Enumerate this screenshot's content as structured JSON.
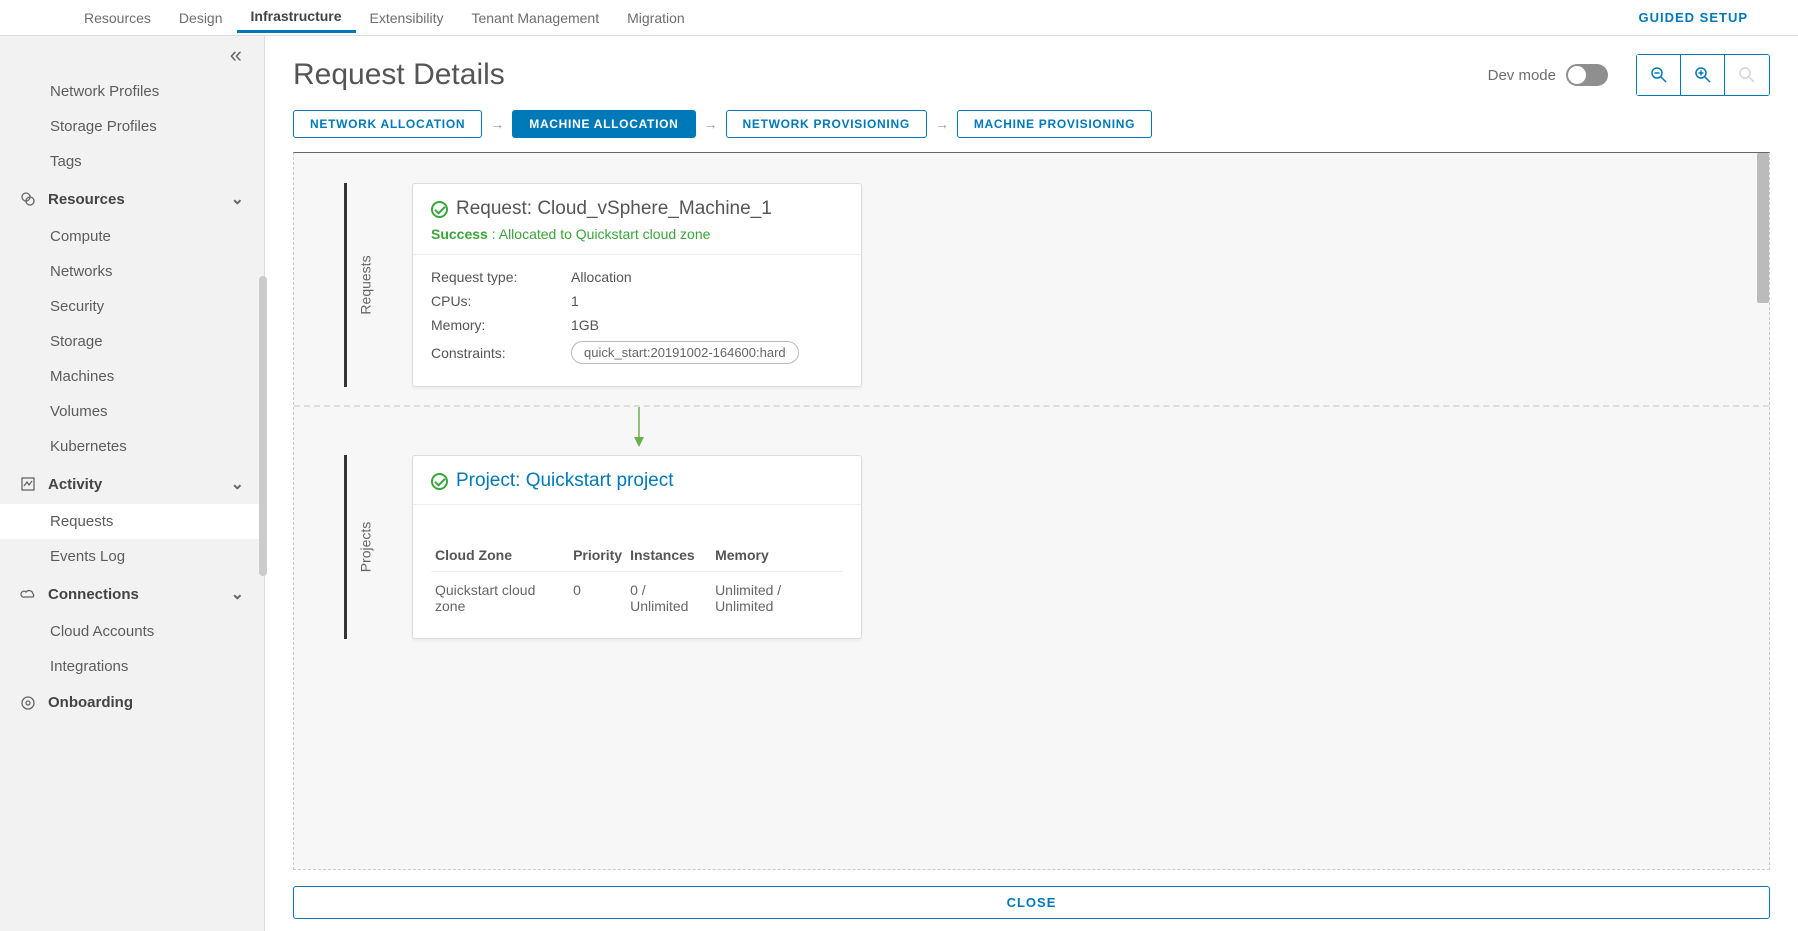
{
  "topnav": {
    "tabs": [
      "Resources",
      "Design",
      "Infrastructure",
      "Extensibility",
      "Tenant Management",
      "Migration"
    ],
    "active": "Infrastructure",
    "guided": "GUIDED SETUP"
  },
  "sidebar": {
    "items": [
      {
        "type": "item",
        "label": "Network Profiles"
      },
      {
        "type": "item",
        "label": "Storage Profiles"
      },
      {
        "type": "item",
        "label": "Tags"
      },
      {
        "type": "group",
        "label": "Resources",
        "icon": "resources"
      },
      {
        "type": "item",
        "label": "Compute"
      },
      {
        "type": "item",
        "label": "Networks"
      },
      {
        "type": "item",
        "label": "Security"
      },
      {
        "type": "item",
        "label": "Storage"
      },
      {
        "type": "item",
        "label": "Machines"
      },
      {
        "type": "item",
        "label": "Volumes"
      },
      {
        "type": "item",
        "label": "Kubernetes"
      },
      {
        "type": "group",
        "label": "Activity",
        "icon": "activity"
      },
      {
        "type": "item",
        "label": "Requests",
        "active": true
      },
      {
        "type": "item",
        "label": "Events Log"
      },
      {
        "type": "group",
        "label": "Connections",
        "icon": "cloud"
      },
      {
        "type": "item",
        "label": "Cloud Accounts"
      },
      {
        "type": "item",
        "label": "Integrations"
      },
      {
        "type": "group",
        "label": "Onboarding",
        "icon": "onboard"
      }
    ]
  },
  "page": {
    "title": "Request Details",
    "devmode": "Dev mode",
    "close": "CLOSE",
    "steps": [
      "NETWORK ALLOCATION",
      "MACHINE ALLOCATION",
      "NETWORK PROVISIONING",
      "MACHINE PROVISIONING"
    ],
    "active_step": "MACHINE ALLOCATION"
  },
  "request_card": {
    "title": "Request: Cloud_vSphere_Machine_1",
    "status_label": "Success",
    "status_msg": ": Allocated to Quickstart cloud zone",
    "rows": {
      "k0": "Request type:",
      "v0": "Allocation",
      "k1": "CPUs:",
      "v1": "1",
      "k2": "Memory:",
      "v2": "1GB",
      "k3": "Constraints:",
      "tag": "quick_start:20191002-164600:hard"
    },
    "lane": "Requests"
  },
  "project_card": {
    "title": "Project: Quickstart project",
    "lane": "Projects",
    "cols": [
      "Cloud Zone",
      "Priority",
      "Instances",
      "Memory"
    ],
    "row": {
      "zone": "Quickstart cloud zone",
      "priority": "0",
      "instances": "0 / Unlimited",
      "memory": "Unlimited / Unlimited"
    }
  }
}
